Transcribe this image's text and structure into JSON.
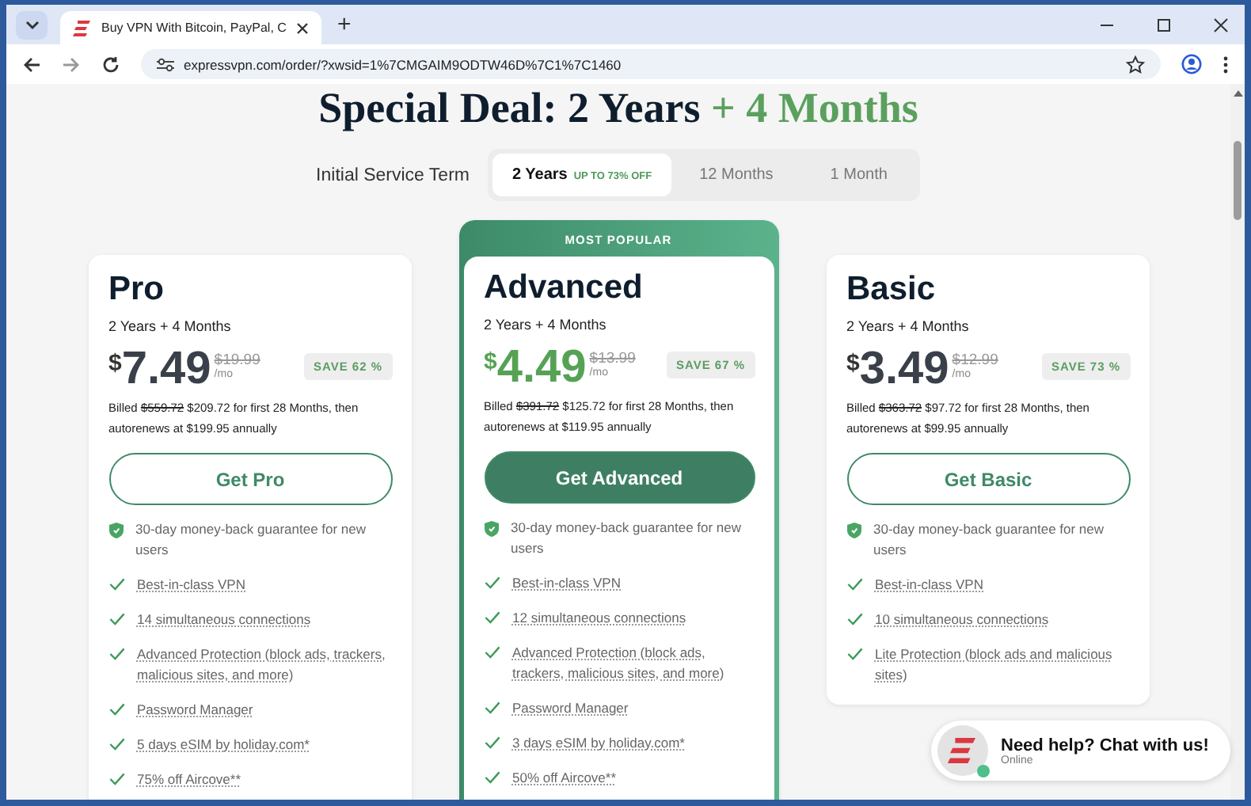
{
  "browser": {
    "tab_title": "Buy VPN With Bitcoin, PayPal, C",
    "new_tab": "+",
    "url": "expressvpn.com/order/?xwsid=1%7CMGAIM9ODTW46D%7C1%7C1460"
  },
  "headline": {
    "main": "Special Deal: 2 Years",
    "accent": "+ 4 Months"
  },
  "term": {
    "label": "Initial Service Term",
    "options": [
      {
        "label": "2 Years",
        "badge": "UP TO 73% OFF",
        "selected": true
      },
      {
        "label": "12 Months",
        "selected": false
      },
      {
        "label": "1 Month",
        "selected": false
      }
    ]
  },
  "plans": [
    {
      "name": "Pro",
      "featured": false,
      "term": "2 Years + 4 Months",
      "currency": "$",
      "price": "7.49",
      "old_price": "$19.99",
      "per": "/mo",
      "save": "SAVE 62 %",
      "billed_label": "Billed",
      "billed_old": "$559.72",
      "billed_text": "$209.72 for first 28 Months, then autorenews at $199.95 annually",
      "button": "Get Pro",
      "features": [
        {
          "kind": "guarantee",
          "text": "30-day money-back guarantee for new users"
        },
        {
          "kind": "check",
          "text": "Best-in-class VPN"
        },
        {
          "kind": "check",
          "text": "14 simultaneous connections"
        },
        {
          "kind": "check",
          "text": "Advanced Protection (block ads, trackers, malicious sites, and more)"
        },
        {
          "kind": "check",
          "text": "Password Manager"
        },
        {
          "kind": "check",
          "text": "5 days eSIM by holiday.com*"
        },
        {
          "kind": "check",
          "text": "75% off Aircove**"
        }
      ]
    },
    {
      "name": "Advanced",
      "featured": true,
      "badge": "MOST POPULAR",
      "term": "2 Years + 4 Months",
      "currency": "$",
      "price": "4.49",
      "old_price": "$13.99",
      "per": "/mo",
      "save": "SAVE 67 %",
      "billed_label": "Billed",
      "billed_old": "$391.72",
      "billed_text": "$125.72 for first 28 Months, then autorenews at $119.95 annually",
      "button": "Get Advanced",
      "features": [
        {
          "kind": "guarantee",
          "text": "30-day money-back guarantee for new users"
        },
        {
          "kind": "check",
          "text": "Best-in-class VPN"
        },
        {
          "kind": "check",
          "text": "12 simultaneous connections"
        },
        {
          "kind": "check",
          "text": "Advanced Protection (block ads, trackers, malicious sites, and more)"
        },
        {
          "kind": "check",
          "text": "Password Manager"
        },
        {
          "kind": "check",
          "text": "3 days eSIM by holiday.com*"
        },
        {
          "kind": "check",
          "text": "50% off Aircove**"
        }
      ]
    },
    {
      "name": "Basic",
      "featured": false,
      "term": "2 Years + 4 Months",
      "currency": "$",
      "price": "3.49",
      "old_price": "$12.99",
      "per": "/mo",
      "save": "SAVE 73 %",
      "billed_label": "Billed",
      "billed_old": "$363.72",
      "billed_text": "$97.72 for first 28 Months, then autorenews at $99.95 annually",
      "button": "Get Basic",
      "features": [
        {
          "kind": "guarantee",
          "text": "30-day money-back guarantee for new users"
        },
        {
          "kind": "check",
          "text": "Best-in-class VPN"
        },
        {
          "kind": "check",
          "text": "10 simultaneous connections"
        },
        {
          "kind": "check",
          "text": "Lite Protection (block ads and malicious sites)"
        }
      ]
    }
  ],
  "chat": {
    "title": "Need help? Chat with us!",
    "status": "Online",
    "online": true
  }
}
